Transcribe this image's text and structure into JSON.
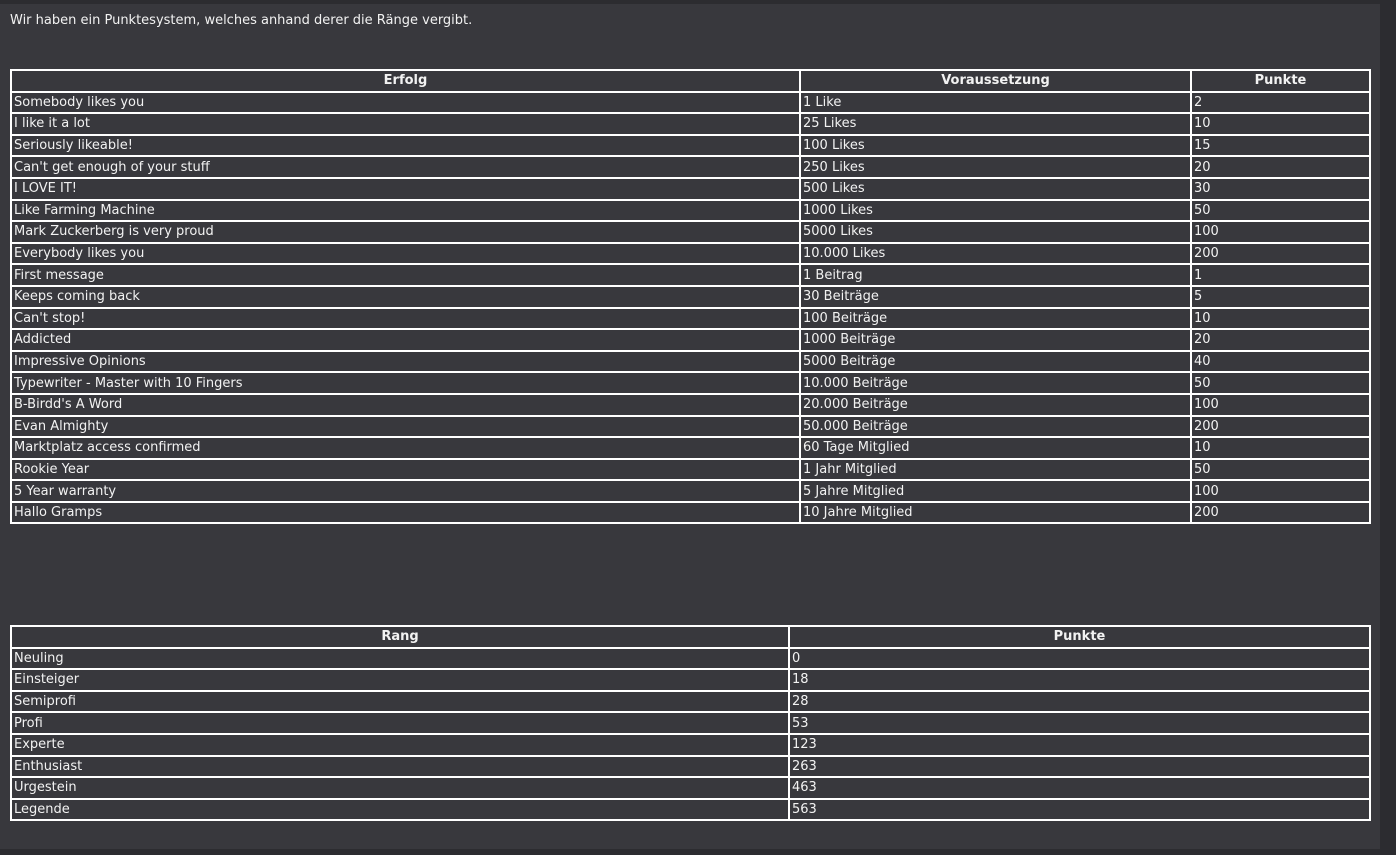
{
  "intro_text": "Wir haben ein Punktesystem, welches anhand derer die Ränge vergibt.",
  "achievements": {
    "headers": [
      "Erfolg",
      "Voraussetzung",
      "Punkte"
    ],
    "rows": [
      [
        "Somebody likes you",
        "1 Like",
        "2"
      ],
      [
        "I like it a lot",
        "25 Likes",
        "10"
      ],
      [
        "Seriously likeable!",
        "100 Likes",
        "15"
      ],
      [
        "Can't get enough of your stuff",
        "250 Likes",
        "20"
      ],
      [
        "I LOVE IT!",
        "500 Likes",
        "30"
      ],
      [
        "Like Farming Machine",
        "1000 Likes",
        "50"
      ],
      [
        "Mark Zuckerberg is very proud",
        "5000 Likes",
        "100"
      ],
      [
        "Everybody likes you",
        "10.000 Likes",
        "200"
      ],
      [
        "First message",
        "1 Beitrag",
        "1"
      ],
      [
        "Keeps coming back",
        "30 Beiträge",
        "5"
      ],
      [
        "Can't stop!",
        "100 Beiträge",
        "10"
      ],
      [
        "Addicted",
        "1000 Beiträge",
        "20"
      ],
      [
        "Impressive Opinions",
        "5000 Beiträge",
        "40"
      ],
      [
        "Typewriter - Master with 10 Fingers",
        "10.000 Beiträge",
        "50"
      ],
      [
        "B-Birdd's A Word",
        "20.000 Beiträge",
        "100"
      ],
      [
        "Evan Almighty",
        "50.000 Beiträge",
        "200"
      ],
      [
        "Marktplatz access confirmed",
        "60 Tage Mitglied",
        "10"
      ],
      [
        "Rookie Year",
        "1 Jahr Mitglied",
        "50"
      ],
      [
        "5 Year warranty",
        "5 Jahre Mitglied",
        "100"
      ],
      [
        "Hallo Gramps",
        "10 Jahre Mitglied",
        "200"
      ]
    ]
  },
  "ranks": {
    "headers": [
      "Rang",
      "Punkte"
    ],
    "rows": [
      [
        "Neuling",
        "0"
      ],
      [
        "Einsteiger",
        "18"
      ],
      [
        "Semiprofi",
        "28"
      ],
      [
        "Profi",
        "53"
      ],
      [
        "Experte",
        "123"
      ],
      [
        "Enthusiast",
        "263"
      ],
      [
        "Urgestein",
        "463"
      ],
      [
        "Legende",
        "563"
      ]
    ]
  },
  "colors": {
    "page_background": "#2c2c30",
    "panel_background": "#38383d",
    "text": "#f2f2f2",
    "border": "#ffffff"
  }
}
